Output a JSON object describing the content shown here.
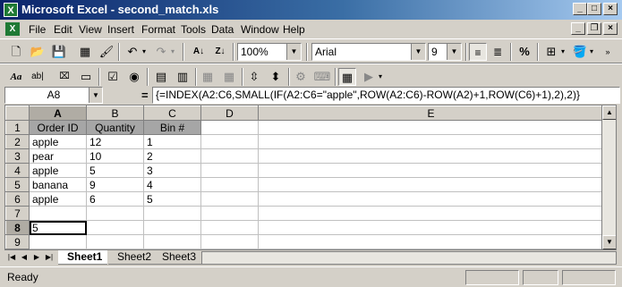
{
  "window": {
    "title": "Microsoft Excel - second_match.xls",
    "app_icon": "X"
  },
  "menu": {
    "items": [
      "File",
      "Edit",
      "View",
      "Insert",
      "Format",
      "Tools",
      "Data",
      "Window",
      "Help"
    ]
  },
  "toolbar": {
    "zoom": "100%",
    "font_name": "Arial",
    "font_size": "9",
    "percent_symbol": "%"
  },
  "formula_bar": {
    "name_box": "A8",
    "equals": "=",
    "formula": "{=INDEX(A2:C6,SMALL(IF(A2:C6=\"apple\",ROW(A2:C6)-ROW(A2)+1,ROW(C6)+1),2),2)}"
  },
  "sheet": {
    "column_headers": [
      "A",
      "B",
      "C",
      "D",
      "E"
    ],
    "rows": [
      {
        "num": "1",
        "cells": [
          "Order ID",
          "Quantity",
          "Bin #",
          "",
          ""
        ]
      },
      {
        "num": "2",
        "cells": [
          "apple",
          "12",
          "1",
          "",
          ""
        ]
      },
      {
        "num": "3",
        "cells": [
          "pear",
          "10",
          "2",
          "",
          ""
        ]
      },
      {
        "num": "4",
        "cells": [
          "apple",
          "5",
          "3",
          "",
          ""
        ]
      },
      {
        "num": "5",
        "cells": [
          "banana",
          "9",
          "4",
          "",
          ""
        ]
      },
      {
        "num": "6",
        "cells": [
          "apple",
          "6",
          "5",
          "",
          ""
        ]
      },
      {
        "num": "7",
        "cells": [
          "",
          "",
          "",
          "",
          ""
        ]
      },
      {
        "num": "8",
        "cells": [
          "5",
          "",
          "",
          "",
          ""
        ]
      },
      {
        "num": "9",
        "cells": [
          "",
          "",
          "",
          "",
          ""
        ]
      }
    ],
    "active_cell": "A8"
  },
  "tabs": {
    "sheets": [
      "Sheet1",
      "Sheet2",
      "Sheet3"
    ],
    "active": "Sheet1"
  },
  "status": {
    "text": "Ready"
  }
}
